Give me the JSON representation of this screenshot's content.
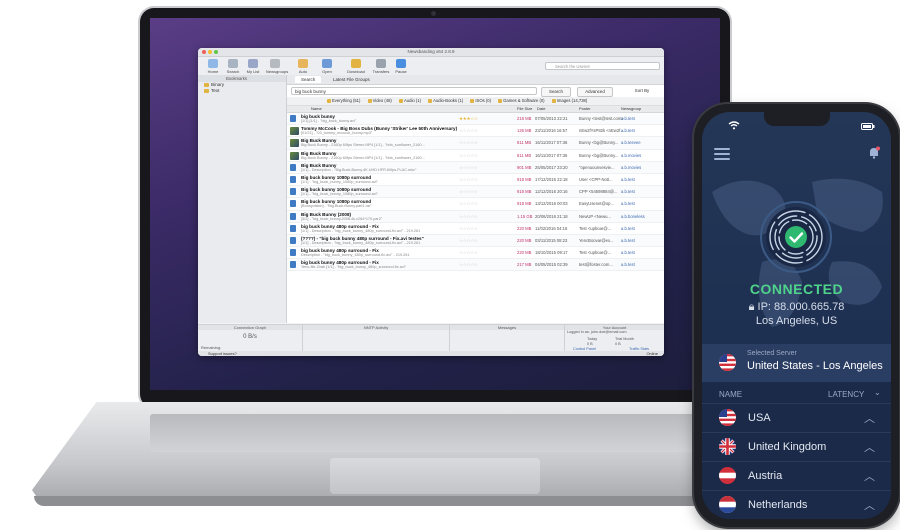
{
  "laptop_app": {
    "window_title": "Newsbanding x64 2.8.9",
    "toolbar": [
      "Home",
      "Search",
      "My List",
      "Newsgroups",
      "Auto Search",
      "Open NZB",
      "Download Folder",
      "Transfers",
      "Pause"
    ],
    "global_search_placeholder": "Search the Usenet",
    "sidebar": {
      "header": "Bookmarks",
      "items": [
        "Binary",
        "Text"
      ]
    },
    "tabs": [
      "Search",
      "Latest File Groups"
    ],
    "query": "big buck bunny",
    "search_button": "Search",
    "advanced_button": "Advanced",
    "sort_label": "Sort By",
    "categories": [
      "Everything (51)",
      "Video (48)",
      "Audio (1)",
      "Audio-Books (1)",
      "ISOs (0)",
      "Games & Software (0)",
      "Images (14,738)"
    ],
    "columns": {
      "name": "Name",
      "size": "File Size",
      "date": "Date",
      "poster": "Poster",
      "group": "Newsgroup"
    },
    "rows": [
      {
        "name": "big buck bunny",
        "sub": "[1/1] [1/1] - \"big_buck_bunny.avi\"",
        "stars": "★★★☆☆",
        "rated": true,
        "size": "218 MB",
        "date": "07/05/2013 22:21",
        "poster": "Bunny <test@test.com>",
        "group": "a.b.test",
        "image": false
      },
      {
        "name": "Tommy McCook - Big Boss Dubs (Bunny 'Striker' Lee 50th Anniversary)",
        "sub": "[01/21] - \"03_tommy_mccook_bunny.mp3\"",
        "stars": "☆☆☆☆☆",
        "rated": false,
        "size": "126 MB",
        "date": "23/11/2016 16:57",
        "poster": "nEw2fYsP82k <nEw2f...",
        "group": "a.b.test",
        "image": true
      },
      {
        "name": "Big Buck Bunny",
        "sub": "Big Buck Bunny - 2160p 60fps Stereo MP4 [1/1] - \"bbb_sunflower_2160...",
        "stars": "☆☆☆☆☆",
        "rated": false,
        "size": "811 MB",
        "date": "16/11/2017 07:36",
        "poster": "Bunny <bg@Bunny...",
        "group": "a.b.teevee",
        "image": true
      },
      {
        "name": "Big Buck Bunny",
        "sub": "Big Buck Bunny - 2160p 60fps Stereo MP4 [1/1] - \"bbb_sunflower_2160...",
        "stars": "☆☆☆☆☆",
        "rated": false,
        "size": "811 MB",
        "date": "16/11/2017 07:36",
        "poster": "Bunny <bg@Bunny...",
        "group": "a.b.movies",
        "image": true
      },
      {
        "name": "Big Buck Bunny",
        "sub": "[1/1] - Description - \"Big.Buck.Bunny.4K.UHD.HFR.60fps.FLAC.mkv\"",
        "stars": "☆☆☆☆☆",
        "rated": false,
        "size": "901 MB",
        "date": "25/05/2017 23:20",
        "poster": "\"openuounvesvie...",
        "group": "a.b.movies",
        "image": false
      },
      {
        "name": "Big buck bunny 1080p surround",
        "sub": "[1/1] - \"big_buck_bunny_1080p_surround.avi\"",
        "stars": "☆☆☆☆☆",
        "rated": false,
        "size": "918 MB",
        "date": "17/12/2016 22:18",
        "poster": "User <CPP-Nott...",
        "group": "a.b.test",
        "image": false
      },
      {
        "name": "Big buck bunny 1080p surround",
        "sub": "[1/1] - \"big_buck_bunny_1080p_surround.avi\"",
        "stars": "☆☆☆☆☆",
        "rated": false,
        "size": "918 MB",
        "date": "12/12/2016 20:16",
        "poster": "CPP <54598884@...",
        "group": "a.b.test",
        "image": false
      },
      {
        "name": "Big buck bunny 1080p surround",
        "sub": "[Bunnyvision] - \"Big.Buck.Bunny.part1.rar\"",
        "stars": "☆☆☆☆☆",
        "rated": false,
        "size": "918 MB",
        "date": "13/12/2016 00:03",
        "poster": "EasyUsenet@op...",
        "group": "a.b.test",
        "image": false
      },
      {
        "name": "Big Buck Bunny (2008)",
        "sub": "[3/2] - \"big_buck_bunny.2008.4k.x264*170.par2\"",
        "stars": "☆☆☆☆☆",
        "rated": false,
        "size": "1.15 GB",
        "date": "20/06/2016 21:18",
        "poster": "NewUP <Newu...",
        "group": "a.b.boneless",
        "image": false
      },
      {
        "name": "big buck bunny 480p surround - Fix",
        "sub": "[1/1] - Description - \"big_buck_bunny_480p_surround-fix.avi\" - 219.261",
        "stars": "☆☆☆☆☆",
        "rated": false,
        "size": "220 MB",
        "date": "11/02/2016 04:16",
        "poster": "Test <upboar@...",
        "group": "a.b.test",
        "image": false
      },
      {
        "name": "(????) - \"big buck bunny 480p surround - Fix.avi testes\"",
        "sub": "[1/1] - Description - \"big_buck_bunny_480p_surround-fix.avi\" - 219.261",
        "stars": "☆☆☆☆☆",
        "rated": false,
        "size": "220 MB",
        "date": "03/11/2015 08:23",
        "poster": "YencBoovar@ex...",
        "group": "a.b.test",
        "image": false
      },
      {
        "name": "big buck bunny 480p surround - Fix",
        "sub": "Description - \"big_buck_bunny_480p_surround-fix.avi\" - 219.261",
        "stars": "☆☆☆☆☆",
        "rated": false,
        "size": "220 MB",
        "date": "18/10/2015 09:17",
        "poster": "Test <upboar@...",
        "group": "a.b.test",
        "image": false
      },
      {
        "name": "big buck bunny 480p surround - Fix",
        "sub": "Yenc-file-Grab [1/1] - \"big_buck_bunny_480p_surround-fix.avi\"",
        "stars": "☆☆☆☆☆",
        "rated": false,
        "size": "217 MB",
        "date": "04/05/2015 02:39",
        "poster": "test@foster.com...",
        "group": "a.b.test",
        "image": false
      }
    ],
    "panels": [
      "Connection Graph",
      "NNTP Activity",
      "Messages",
      "Your Account"
    ],
    "speed": "0 B/s",
    "remaining_label": "Remaining:",
    "remaining_value": "0 B",
    "remaining_time": "00:00:00",
    "account": {
      "logged_in": "Logged in as: john.doe@email.com",
      "today": "Today",
      "trial": "Trial Month",
      "today_val": "0 B",
      "trial_val": "0 B",
      "control_panel": "Control Panel",
      "traffic": "Traffic Stats"
    },
    "status": {
      "support": "Support issues?",
      "online": "Online"
    }
  },
  "phone_app": {
    "status": "CONNECTED",
    "ip": "IP: 88.000.665.78",
    "city": "Los Angeles, US",
    "selected_label": "Selected Server",
    "selected_value": "United States - Los Angeles",
    "col_name": "NAME",
    "col_latency": "LATENCY",
    "servers": [
      "USA",
      "United Kingdom",
      "Austria",
      "Netherlands"
    ],
    "colors": {
      "accent": "#4fd38b",
      "bg": "#1f3152"
    }
  }
}
